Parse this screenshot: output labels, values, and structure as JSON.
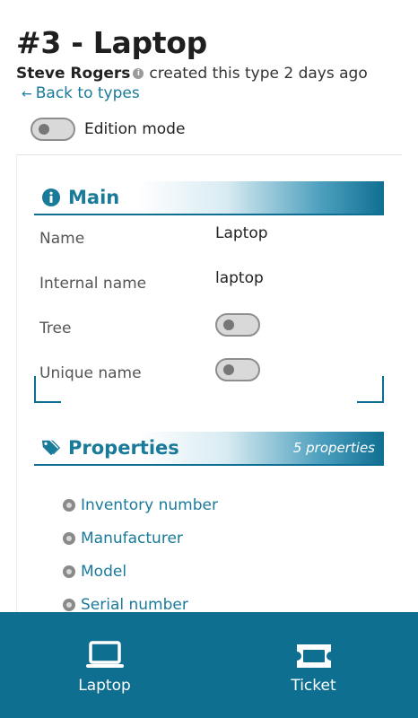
{
  "header": {
    "title": "#3 - Laptop",
    "author": "Steve Rogers",
    "created_text": "created this type 2 days ago",
    "back_label": "Back to types"
  },
  "edition": {
    "label": "Edition mode",
    "enabled": false
  },
  "main_section": {
    "heading": "Main",
    "icon": "info-circle-icon",
    "fields": [
      {
        "label": "Name",
        "value": "Laptop"
      },
      {
        "label": "Internal name",
        "value": "laptop"
      },
      {
        "label": "Tree",
        "toggle": false
      },
      {
        "label": "Unique name",
        "toggle": false
      }
    ]
  },
  "properties_section": {
    "heading": "Properties",
    "icon": "tags-icon",
    "count_text": "5 properties",
    "items": [
      "Inventory number",
      "Manufacturer",
      "Model",
      "Serial number"
    ]
  },
  "bottom_nav": {
    "items": [
      {
        "label": "Laptop",
        "icon": "laptop-icon"
      },
      {
        "label": "Ticket",
        "icon": "ticket-icon"
      }
    ]
  },
  "colors": {
    "accent": "#1a7a99",
    "nav_background": "#0e6f91",
    "text": "#222222"
  }
}
